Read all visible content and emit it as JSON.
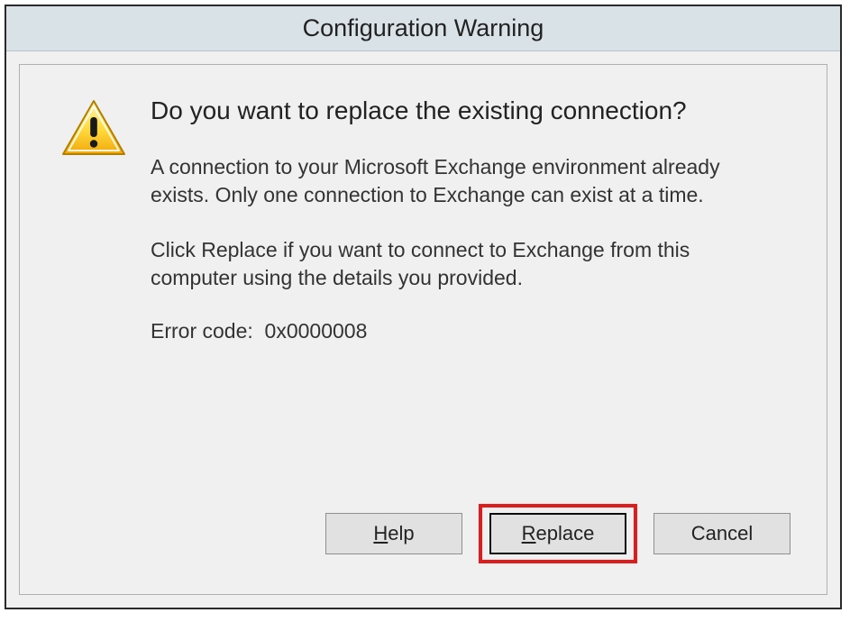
{
  "dialog": {
    "title": "Configuration Warning",
    "heading": "Do you want to replace the existing connection?",
    "body1": "A connection to your Microsoft Exchange environment already exists. Only one connection to Exchange can exist at a time.",
    "body2": "Click Replace if you want to connect to Exchange from this computer using the details you provided.",
    "error_label": "Error code:",
    "error_code": "0x0000008",
    "buttons": {
      "help": "Help",
      "replace": "Replace",
      "cancel": "Cancel"
    }
  }
}
